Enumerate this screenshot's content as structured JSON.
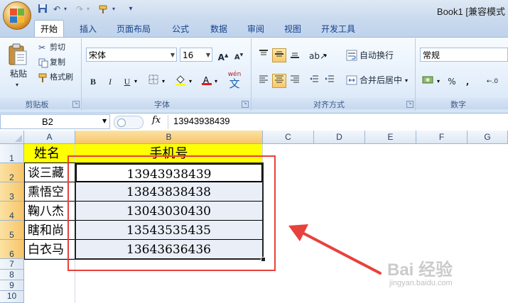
{
  "window": {
    "title": "Book1 [兼容模式"
  },
  "quick_access": {
    "save_icon": "save-icon",
    "undo_icon": "undo-icon",
    "redo_icon": "redo-icon",
    "brush_icon": "format-brush-icon"
  },
  "tabs": [
    "开始",
    "插入",
    "页面布局",
    "公式",
    "数据",
    "审阅",
    "视图",
    "开发工具"
  ],
  "ribbon": {
    "clipboard": {
      "paste": "粘贴",
      "cut": "剪切",
      "copy": "复制",
      "format_painter": "格式刷",
      "label": "剪贴板"
    },
    "font": {
      "name": "宋体",
      "size": "16",
      "bold": "B",
      "italic": "I",
      "underline": "U",
      "phonetic": "wén",
      "label": "字体"
    },
    "alignment": {
      "wrap": "自动换行",
      "merge": "合并后居中",
      "label": "对齐方式"
    },
    "number": {
      "format": "常规",
      "percent": "%",
      "comma": ",",
      "label": "数字"
    }
  },
  "formula_bar": {
    "name_box": "B2",
    "fx": "fx",
    "content": "13943938439"
  },
  "columns": [
    "A",
    "B",
    "C",
    "D",
    "E",
    "F",
    "G"
  ],
  "rows": [
    "1",
    "2",
    "3",
    "4",
    "5",
    "6",
    "7",
    "8",
    "9",
    "10"
  ],
  "cells": {
    "a1": "姓名",
    "b1": "手机号",
    "names": [
      "谈三藏",
      "熏悟空",
      "鞠八杰",
      "瞎和尚",
      "白衣马"
    ],
    "phones": [
      "13943938439",
      "13843838438",
      "13043030430",
      "13543535435",
      "13643636436"
    ]
  },
  "watermark": {
    "brand": "Bai 经验",
    "url": "jingyan.baidu.com"
  },
  "colors": {
    "header_fill": "#ffff00",
    "annotation_red": "#e8413c",
    "selection": "#e9eef7"
  }
}
